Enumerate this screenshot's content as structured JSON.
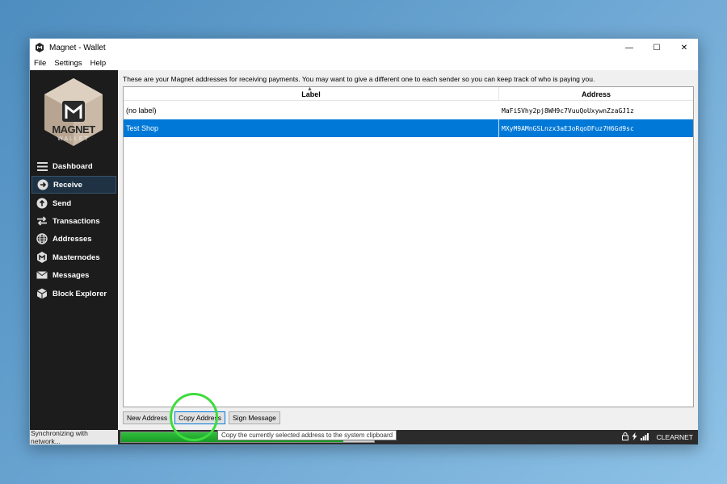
{
  "window": {
    "title": "Magnet - Wallet",
    "controls": {
      "minimize": "—",
      "maximize": "☐",
      "close": "✕"
    }
  },
  "menu": [
    "File",
    "Settings",
    "Help"
  ],
  "logo": {
    "brand": "MAGNET",
    "sub": "WALLET"
  },
  "sidebar": {
    "items": [
      {
        "label": "Dashboard",
        "icon": "menu-icon"
      },
      {
        "label": "Receive",
        "icon": "arrow-right-circle-icon",
        "active": true
      },
      {
        "label": "Send",
        "icon": "arrow-up-circle-icon"
      },
      {
        "label": "Transactions",
        "icon": "transfer-icon"
      },
      {
        "label": "Addresses",
        "icon": "globe-icon"
      },
      {
        "label": "Masternodes",
        "icon": "magnet-logo-icon"
      },
      {
        "label": "Messages",
        "icon": "envelope-icon"
      },
      {
        "label": "Block Explorer",
        "icon": "cube-icon"
      }
    ]
  },
  "main": {
    "description": "These are your Magnet addresses for receiving payments. You may want to give a different one to each sender so you can keep track of who is paying you.",
    "table": {
      "columns": [
        "Label",
        "Address"
      ],
      "rows": [
        {
          "label": "(no label)",
          "address": "MaFiSVhy2pj8WH9c7VuuQoUxywnZzaGJ1z",
          "selected": false
        },
        {
          "label": "Test Shop",
          "address": "MXyM9AMnGSLnzx3aE3oRqoDFuz7H6Gd9sc",
          "selected": true
        }
      ]
    },
    "buttons": {
      "new": "New Address",
      "copy": "Copy Address",
      "sign": "Sign Message"
    }
  },
  "status": {
    "sync_text": "Synchronizing with network...",
    "progress_fraction": 0.88,
    "network": "CLEARNET"
  },
  "tooltip": "Copy the currently selected address to the system clipboard",
  "colors": {
    "accent": "#0078d7",
    "sidebar": "#1c1c1c",
    "progress": "#1fae2c",
    "highlight": "#3ddc3d"
  }
}
